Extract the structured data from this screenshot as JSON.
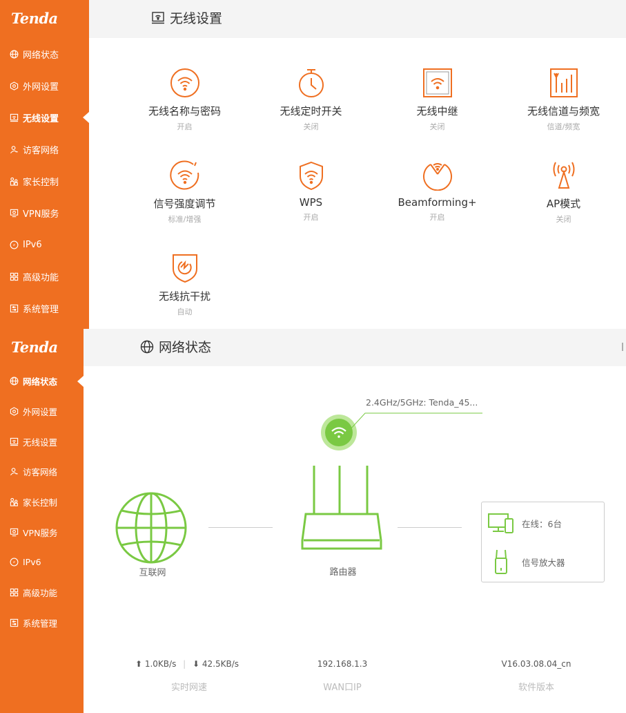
{
  "brand": {
    "logo": "Tenda",
    "accent": "#ef6f21",
    "green": "#7ac943"
  },
  "panel1": {
    "title": "无线设置",
    "nav": [
      {
        "label": "网络状态",
        "icon": "globe-icon"
      },
      {
        "label": "外网设置",
        "icon": "wan-icon"
      },
      {
        "label": "无线设置",
        "icon": "wireless-icon",
        "active": true
      },
      {
        "label": "访客网络",
        "icon": "guest-icon"
      },
      {
        "label": "家长控制",
        "icon": "parental-icon"
      },
      {
        "label": "VPN服务",
        "icon": "vpn-icon"
      },
      {
        "label": "IPv6",
        "icon": "ipv6-icon"
      },
      {
        "label": "高级功能",
        "icon": "advanced-icon"
      },
      {
        "label": "系统管理",
        "icon": "system-icon"
      }
    ],
    "tiles": [
      {
        "label": "无线名称与密码",
        "status": "开启",
        "icon": "wifi-circle-icon"
      },
      {
        "label": "无线定时开关",
        "status": "关闭",
        "icon": "timer-icon"
      },
      {
        "label": "无线中继",
        "status": "关闭",
        "icon": "repeater-icon"
      },
      {
        "label": "无线信道与频宽",
        "status": "信道/频宽",
        "icon": "channel-icon"
      },
      {
        "label": "信号强度调节",
        "status": "标准/增强",
        "icon": "signal-strength-icon"
      },
      {
        "label": "WPS",
        "status": "开启",
        "icon": "wps-shield-icon"
      },
      {
        "label": "Beamforming+",
        "status": "开启",
        "icon": "beamforming-icon"
      },
      {
        "label": "AP模式",
        "status": "关闭",
        "icon": "ap-antenna-icon"
      },
      {
        "label": "无线抗干扰",
        "status": "自动",
        "icon": "anti-interference-icon"
      }
    ]
  },
  "panel2": {
    "title": "网络状态",
    "nav": [
      {
        "label": "网络状态",
        "icon": "globe-icon",
        "active": true
      },
      {
        "label": "外网设置",
        "icon": "wan-icon"
      },
      {
        "label": "无线设置",
        "icon": "wireless-icon"
      },
      {
        "label": "访客网络",
        "icon": "guest-icon"
      },
      {
        "label": "家长控制",
        "icon": "parental-icon"
      },
      {
        "label": "VPN服务",
        "icon": "vpn-icon"
      },
      {
        "label": "IPv6",
        "icon": "ipv6-icon"
      },
      {
        "label": "高级功能",
        "icon": "advanced-icon"
      },
      {
        "label": "系统管理",
        "icon": "system-icon"
      }
    ],
    "ssid": "2.4GHz/5GHz: Tenda_45...",
    "internet_label": "互联网",
    "router_label": "路由器",
    "online_label": "在线：6台",
    "extender_label": "信号放大器",
    "upload": "1.0KB/s",
    "separator": "|",
    "download": "42.5KB/s",
    "speed_label": "实时网速",
    "wan_ip": "192.168.1.3",
    "wan_label": "WAN口IP",
    "firmware": "V16.03.08.04_cn",
    "firmware_label": "软件版本"
  }
}
